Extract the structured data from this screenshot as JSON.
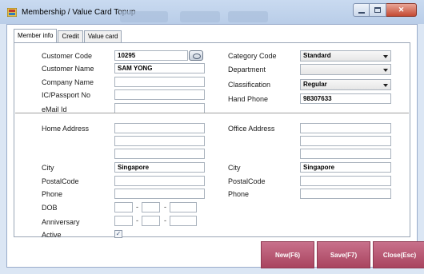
{
  "window": {
    "title": "Membership / Value Card Topup"
  },
  "tabs": [
    {
      "label": "Member info"
    },
    {
      "label": "Credit"
    },
    {
      "label": "Value card"
    }
  ],
  "top": {
    "customer_code_label": "Customer Code",
    "customer_code_value": "10295",
    "customer_name_label": "Customer Name",
    "customer_name_value": "SAM YONG",
    "company_name_label": "Company Name",
    "company_name_value": "",
    "ic_passport_label": "IC/Passport No",
    "ic_passport_value": "",
    "email_label": "eMail Id",
    "email_value": "",
    "category_code_label": "Category Code",
    "category_code_value": "Standard",
    "department_label": "Department",
    "department_value": "",
    "classification_label": "Classification",
    "classification_value": "Regular",
    "hand_phone_label": "Hand Phone",
    "hand_phone_value": "98307633"
  },
  "address": {
    "home_address_label": "Home Address",
    "home_address_lines": [
      "",
      "",
      ""
    ],
    "office_address_label": "Office Address",
    "office_address_lines": [
      "",
      "",
      ""
    ],
    "city_label": "City",
    "city_value": "Singapore",
    "office_city_label": "City",
    "office_city_value": "Singapore",
    "postal_label": "PostalCode",
    "postal_value": "",
    "office_postal_label": "PostalCode",
    "office_postal_value": "",
    "phone_label": "Phone",
    "phone_value": "",
    "office_phone_label": "Phone",
    "office_phone_value": "",
    "dob_label": "DOB",
    "anniversary_label": "Anniversary",
    "date_separator": "-",
    "active_label": "Active",
    "active_checked": true,
    "check_mark": "✓"
  },
  "buttons": {
    "new": "New(F6)",
    "save": "Save(F7)",
    "close": "Close(Esc)"
  },
  "colors": {
    "action_button": "#b5536f",
    "client_background": "#ffffff",
    "titlebar": "#c3d5ee"
  }
}
